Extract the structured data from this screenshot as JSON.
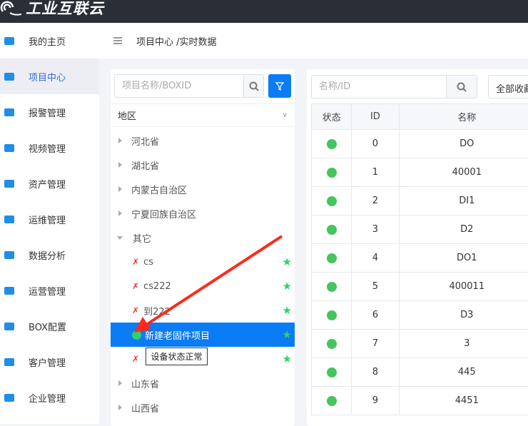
{
  "app": {
    "logo_text": "工业互联云"
  },
  "sidebar": {
    "items": [
      {
        "label": "我的主页",
        "icon": "home-icon"
      },
      {
        "label": "项目中心",
        "icon": "archive-icon",
        "active": true
      },
      {
        "label": "报警管理",
        "icon": "bell-icon"
      },
      {
        "label": "视频管理",
        "icon": "video-icon"
      },
      {
        "label": "资产管理",
        "icon": "asset-icon"
      },
      {
        "label": "运维管理",
        "icon": "gear-wrench-icon"
      },
      {
        "label": "数据分析",
        "icon": "monitor-chart-icon"
      },
      {
        "label": "运营管理",
        "icon": "operation-icon"
      },
      {
        "label": "BOX配置",
        "icon": "box-config-icon"
      },
      {
        "label": "客户管理",
        "icon": "users-icon"
      },
      {
        "label": "企业管理",
        "icon": "briefcase-icon"
      }
    ]
  },
  "header": {
    "breadcrumb": "项目中心 /实时数据"
  },
  "left": {
    "search_placeholder": "项目名称/BOXID",
    "region_label": "地区",
    "tree": [
      {
        "label": "河北省",
        "type": "province"
      },
      {
        "label": "湖北省",
        "type": "province"
      },
      {
        "label": "内蒙古自治区",
        "type": "province"
      },
      {
        "label": "宁夏回族自治区",
        "type": "province"
      },
      {
        "label": "其它",
        "type": "province-open"
      },
      {
        "label": "cs",
        "type": "offline"
      },
      {
        "label": "cs222",
        "type": "offline"
      },
      {
        "label": "到222",
        "type": "offline"
      },
      {
        "label": "新建老固件项目",
        "type": "online",
        "selected": true
      },
      {
        "label": "",
        "type": "offline"
      },
      {
        "label": "山东省",
        "type": "province"
      },
      {
        "label": "山西省",
        "type": "province"
      }
    ],
    "tooltip": "设备状态正常"
  },
  "right": {
    "search_placeholder": "名称/ID",
    "dropdown": "全部收藏",
    "columns": [
      "状态",
      "ID",
      "名称"
    ],
    "rows": [
      {
        "id": "0",
        "name": "DO"
      },
      {
        "id": "1",
        "name": "40001"
      },
      {
        "id": "2",
        "name": "DI1"
      },
      {
        "id": "3",
        "name": "D2"
      },
      {
        "id": "4",
        "name": "DO1"
      },
      {
        "id": "5",
        "name": "400011"
      },
      {
        "id": "6",
        "name": "D3"
      },
      {
        "id": "7",
        "name": "3"
      },
      {
        "id": "8",
        "name": "445"
      },
      {
        "id": "9",
        "name": "4451"
      }
    ]
  },
  "colors": {
    "accent": "#0a7cf5",
    "online": "#2ed16d",
    "topbar": "#2a2e37",
    "annotation": "#ff2a1a"
  }
}
